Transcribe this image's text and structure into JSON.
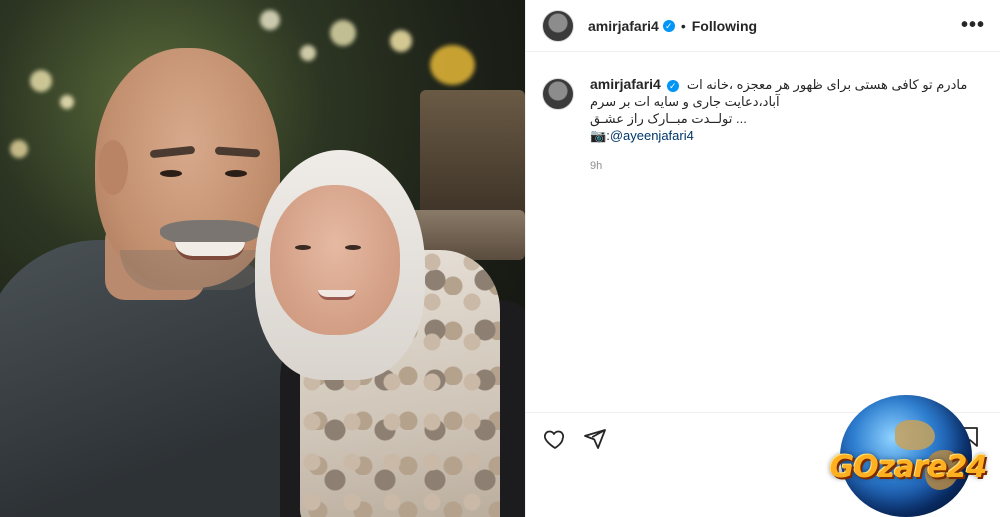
{
  "post": {
    "username": "amirjafari4",
    "verified_mark": "✓",
    "separator": "•",
    "follow_status": "Following",
    "more_icon": "•••"
  },
  "caption": {
    "username": "amirjafari4",
    "line1": "مادرم تو کافی هستی برای ظهور هر معجزه ،خانه ات",
    "line2": "آباد،دعایت جاری و سایه ات بر سرم",
    "line3": "... تولــدت مبــارک راز عشـق",
    "camera_icon": "📷",
    "mention_prefix": ":",
    "mention": "@ayeenjafari4",
    "time": "9h"
  },
  "actions": {
    "like": "heart-icon",
    "share": "send-icon",
    "save": "bookmark-icon"
  },
  "watermark": {
    "text": "GOzare24"
  },
  "colors": {
    "verified": "#0095f6",
    "text": "#262626",
    "muted": "#8e8e8e",
    "mention": "#00376b"
  }
}
